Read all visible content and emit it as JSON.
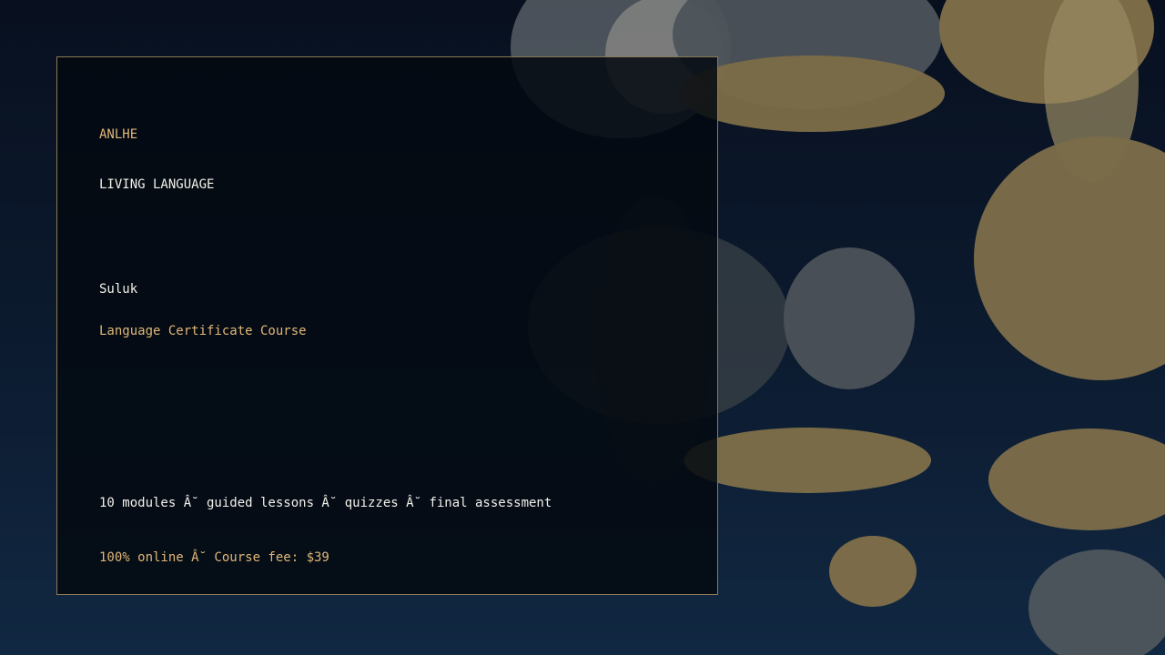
{
  "brand": "ANLHE",
  "tagline": "LIVING LANGUAGE",
  "language": "Suluk",
  "course_title": "Language Certificate Course",
  "features": "10 modules Â˘ guided lessons Â˘ quizzes Â˘ final assessment",
  "pricing": "100% online Â˘ Course fee: $39",
  "colors": {
    "accent": "#e1b778",
    "text": "#f3f1ea",
    "card_border": "#8c7a55",
    "background_top": "#08101f",
    "background_bottom": "#112842",
    "bubble_gold": "#7d6d48",
    "bubble_gray": "#4a5258"
  }
}
